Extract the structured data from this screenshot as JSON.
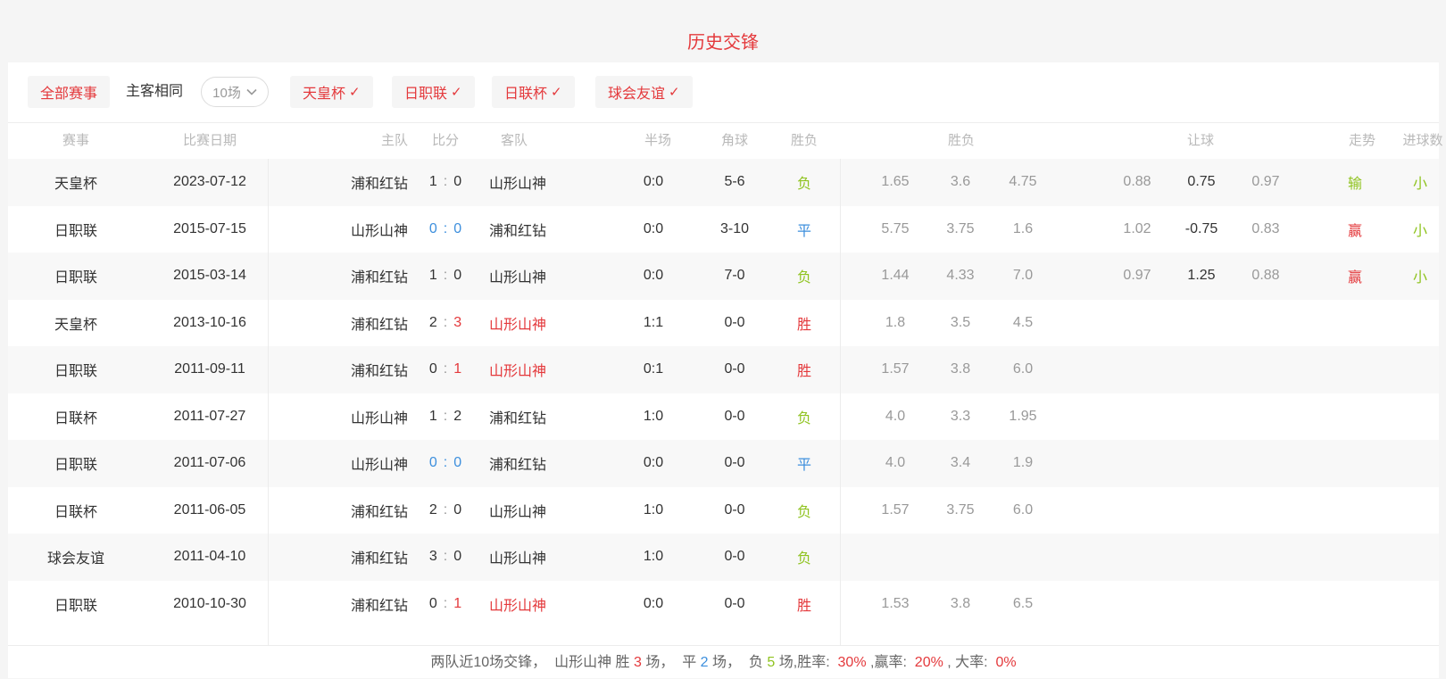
{
  "title": "历史交锋",
  "colors": {
    "red": "#e4393c",
    "green": "#8fc31f",
    "blue": "#3d8fdd",
    "gray": "#999999"
  },
  "filters": {
    "all": "全部赛事",
    "same": "主客相同",
    "count": "10场",
    "check": "✓",
    "tags": [
      "天皇杯",
      "日职联",
      "日联杯",
      "球会友谊"
    ]
  },
  "table": {
    "headers": [
      "赛事",
      "比赛日期",
      "主队",
      "比分",
      "客队",
      "半场",
      "角球",
      "胜负",
      "胜负",
      "让球",
      "走势",
      "进球数"
    ],
    "rows": [
      {
        "league": "天皇杯",
        "date": "2023-07-12",
        "home": "浦和红钻",
        "score_home": "1",
        "score_away": "0",
        "score_style": "dark",
        "away": "山形山神",
        "away_red": false,
        "half": "0:0",
        "corner": "5-6",
        "result": "负",
        "odds": [
          "1.65",
          "3.6",
          "4.75"
        ],
        "handicap": [
          "0.88",
          "0.75",
          "0.97"
        ],
        "trend": "输",
        "goals": "小"
      },
      {
        "league": "日职联",
        "date": "2015-07-15",
        "home": "山形山神",
        "score_home": "0",
        "score_away": "0",
        "score_style": "blue",
        "away": "浦和红钻",
        "away_red": false,
        "half": "0:0",
        "corner": "3-10",
        "result": "平",
        "odds": [
          "5.75",
          "3.75",
          "1.6"
        ],
        "handicap": [
          "1.02",
          "-0.75",
          "0.83"
        ],
        "trend": "赢",
        "goals": "小"
      },
      {
        "league": "日职联",
        "date": "2015-03-14",
        "home": "浦和红钻",
        "score_home": "1",
        "score_away": "0",
        "score_style": "dark",
        "away": "山形山神",
        "away_red": false,
        "half": "0:0",
        "corner": "7-0",
        "result": "负",
        "odds": [
          "1.44",
          "4.33",
          "7.0"
        ],
        "handicap": [
          "0.97",
          "1.25",
          "0.88"
        ],
        "trend": "赢",
        "goals": "小"
      },
      {
        "league": "天皇杯",
        "date": "2013-10-16",
        "home": "浦和红钻",
        "score_home": "2",
        "score_away": "3",
        "score_style": "awaywin",
        "away": "山形山神",
        "away_red": true,
        "half": "1:1",
        "corner": "0-0",
        "result": "胜",
        "odds": [
          "1.8",
          "3.5",
          "4.5"
        ],
        "handicap": [],
        "trend": "",
        "goals": ""
      },
      {
        "league": "日职联",
        "date": "2011-09-11",
        "home": "浦和红钻",
        "score_home": "0",
        "score_away": "1",
        "score_style": "awaywin",
        "away": "山形山神",
        "away_red": true,
        "half": "0:1",
        "corner": "0-0",
        "result": "胜",
        "odds": [
          "1.57",
          "3.8",
          "6.0"
        ],
        "handicap": [],
        "trend": "",
        "goals": ""
      },
      {
        "league": "日联杯",
        "date": "2011-07-27",
        "home": "山形山神",
        "score_home": "1",
        "score_away": "2",
        "score_style": "dark",
        "away": "浦和红钻",
        "away_red": false,
        "half": "1:0",
        "corner": "0-0",
        "result": "负",
        "odds": [
          "4.0",
          "3.3",
          "1.95"
        ],
        "handicap": [],
        "trend": "",
        "goals": ""
      },
      {
        "league": "日职联",
        "date": "2011-07-06",
        "home": "山形山神",
        "score_home": "0",
        "score_away": "0",
        "score_style": "blue",
        "away": "浦和红钻",
        "away_red": false,
        "half": "0:0",
        "corner": "0-0",
        "result": "平",
        "odds": [
          "4.0",
          "3.4",
          "1.9"
        ],
        "handicap": [],
        "trend": "",
        "goals": ""
      },
      {
        "league": "日联杯",
        "date": "2011-06-05",
        "home": "浦和红钻",
        "score_home": "2",
        "score_away": "0",
        "score_style": "dark",
        "away": "山形山神",
        "away_red": false,
        "half": "1:0",
        "corner": "0-0",
        "result": "负",
        "odds": [
          "1.57",
          "3.75",
          "6.0"
        ],
        "handicap": [],
        "trend": "",
        "goals": ""
      },
      {
        "league": "球会友谊",
        "date": "2011-04-10",
        "home": "浦和红钻",
        "score_home": "3",
        "score_away": "0",
        "score_style": "dark",
        "away": "山形山神",
        "away_red": false,
        "half": "1:0",
        "corner": "0-0",
        "result": "负",
        "odds": [],
        "handicap": [],
        "trend": "",
        "goals": ""
      },
      {
        "league": "日职联",
        "date": "2010-10-30",
        "home": "浦和红钻",
        "score_home": "0",
        "score_away": "1",
        "score_style": "awaywin",
        "away": "山形山神",
        "away_red": true,
        "half": "0:0",
        "corner": "0-0",
        "result": "胜",
        "odds": [
          "1.53",
          "3.8",
          "6.5"
        ],
        "handicap": [],
        "trend": "",
        "goals": ""
      }
    ]
  },
  "summary": {
    "segments": [
      {
        "text": "两队近10场交锋，  ",
        "color": "base"
      },
      {
        "text": "山形山神 胜 ",
        "color": "base"
      },
      {
        "text": "3",
        "color": "red"
      },
      {
        "text": " 场，  ",
        "color": "base"
      },
      {
        "text": "平 ",
        "color": "base"
      },
      {
        "text": "2",
        "color": "blue"
      },
      {
        "text": " 场，  ",
        "color": "base"
      },
      {
        "text": "负 ",
        "color": "base"
      },
      {
        "text": "5",
        "color": "green"
      },
      {
        "text": " 场,",
        "color": "base"
      },
      {
        "text": "胜率:  ",
        "color": "base"
      },
      {
        "text": "30%",
        "color": "red"
      },
      {
        "text": " ,赢率:  ",
        "color": "base"
      },
      {
        "text": "20%",
        "color": "red"
      },
      {
        "text": " , 大率:  ",
        "color": "base"
      },
      {
        "text": "0%",
        "color": "red"
      }
    ]
  }
}
